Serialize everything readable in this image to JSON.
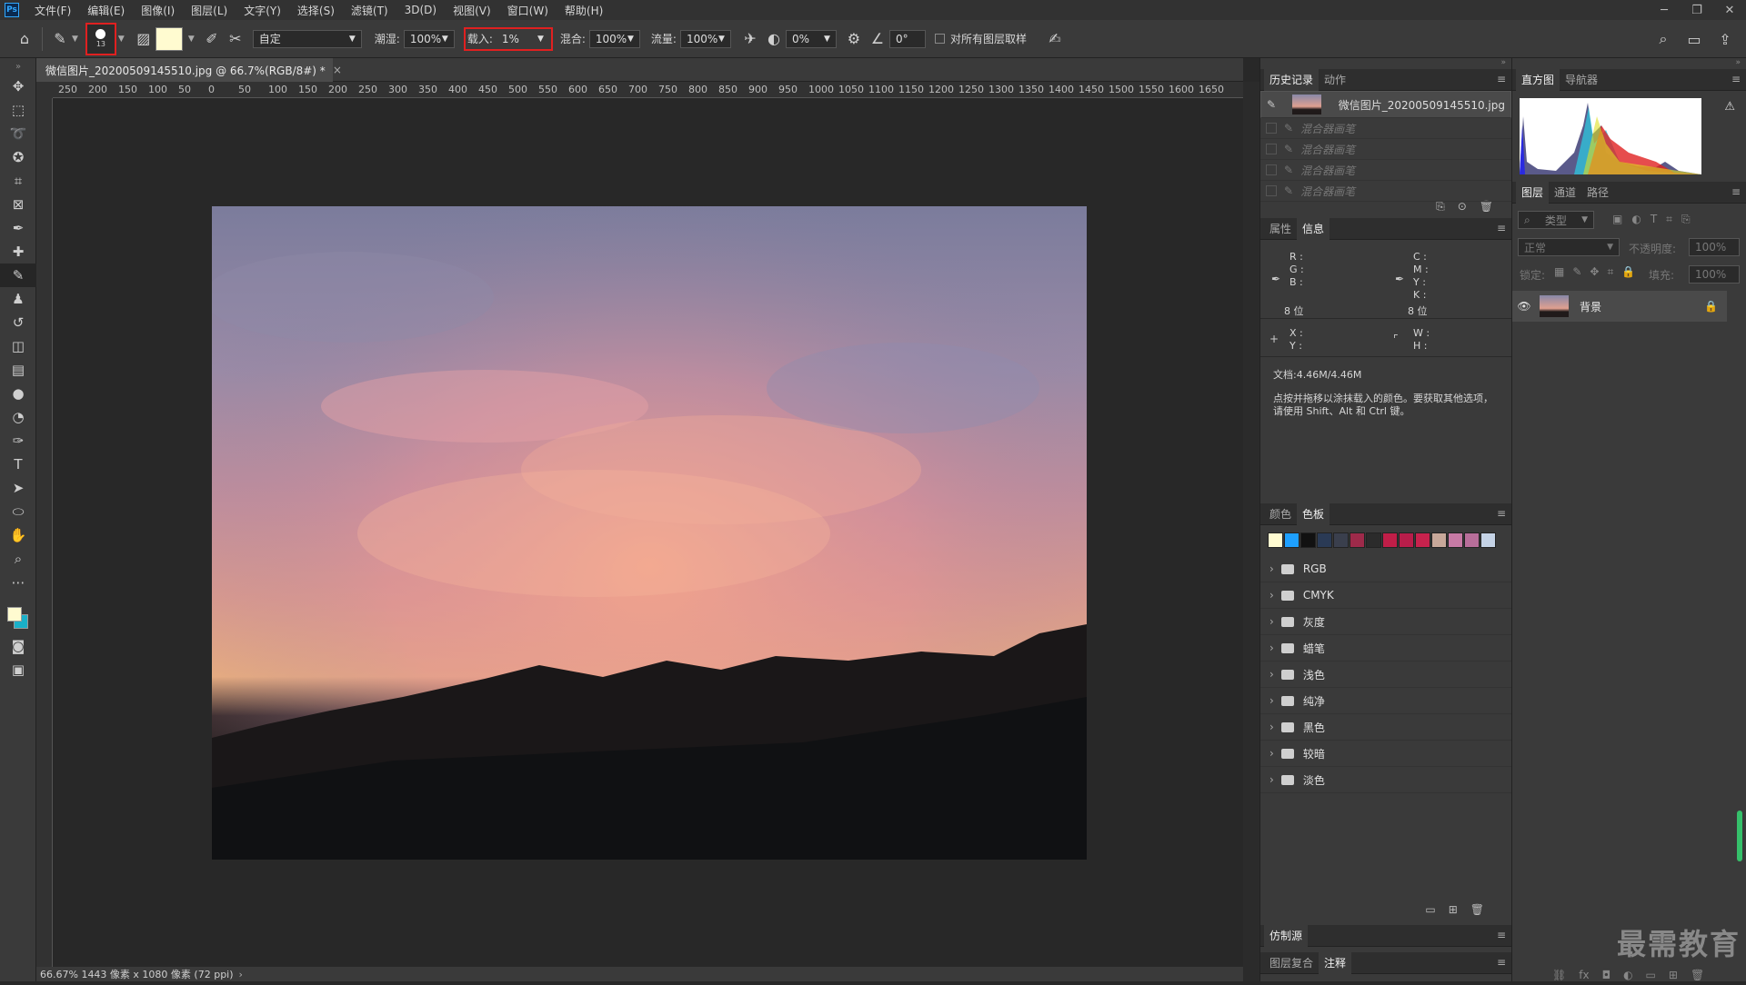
{
  "app": {
    "logo": "Ps",
    "menus": [
      "文件(F)",
      "编辑(E)",
      "图像(I)",
      "图层(L)",
      "文字(Y)",
      "选择(S)",
      "滤镜(T)",
      "3D(D)",
      "视图(V)",
      "窗口(W)",
      "帮助(H)"
    ]
  },
  "options": {
    "brush_size": "13",
    "preset": "自定",
    "wet_label": "潮湿:",
    "wet_value": "100%",
    "load_label": "载入:",
    "load_value": "1%",
    "mix_label": "混合:",
    "mix_value": "100%",
    "flow_label": "流量:",
    "flow_value": "100%",
    "smooth_value": "0%",
    "angle_value": "0°",
    "sample_all_label": "对所有图层取样",
    "swatch_color": "#fffbd0"
  },
  "document": {
    "tab_title": "微信图片_20200509145510.jpg @ 66.7%(RGB/8#) *",
    "ruler_ticks": [
      "250",
      "200",
      "150",
      "100",
      "50",
      "0",
      "50",
      "100",
      "150",
      "200",
      "250",
      "300",
      "350",
      "400",
      "450",
      "500",
      "550",
      "600",
      "650",
      "700",
      "750",
      "800",
      "850",
      "900",
      "950",
      "1000",
      "1050",
      "1100",
      "1150",
      "1200",
      "1250",
      "1300",
      "1350",
      "1400",
      "1450",
      "1500",
      "1550",
      "1600",
      "1650"
    ],
    "status": "66.67%  1443 像素 x 1080 像素 (72 ppi)"
  },
  "history": {
    "tabs": [
      "历史记录",
      "动作"
    ],
    "snapshot": "微信图片_20200509145510.jpg",
    "steps": [
      "混合器画笔",
      "混合器画笔",
      "混合器画笔",
      "混合器画笔"
    ]
  },
  "info": {
    "tabs": [
      "属性",
      "信息"
    ],
    "rgb": "R :\nG :\nB :",
    "cmyk": "C :\nM :\nY :\nK :",
    "bits_left": "8 位",
    "bits_right": "8 位",
    "xy": "X :\nY :",
    "wh": "W :\nH :",
    "doc": "文档:4.46M/4.46M",
    "hint": "点按并拖移以涂抹载入的颜色。要获取其他选项，请使用 Shift、Alt 和 Ctrl 键。"
  },
  "swatches": {
    "tabs": [
      "颜色",
      "色板"
    ],
    "colors": [
      "#fffbd0",
      "#1ea0ff",
      "#111111",
      "#2a3a55",
      "#3a3f4d",
      "#9e2a4a",
      "#2b2b2b",
      "#c01e48",
      "#b81d4a",
      "#c7224d",
      "#c8a89a",
      "#c77aa5",
      "#b86e9a",
      "#c5d3e6"
    ],
    "groups": [
      "RGB",
      "CMYK",
      "灰度",
      "蜡笔",
      "浅色",
      "纯净",
      "黑色",
      "较暗",
      "淡色"
    ]
  },
  "bottom_panels": {
    "clone": "仿制源",
    "tabs": [
      "图层复合",
      "注释"
    ]
  },
  "histogram": {
    "tabs": [
      "直方图",
      "导航器"
    ]
  },
  "layers": {
    "tabs": [
      "图层",
      "通道",
      "路径"
    ],
    "filter": "类型",
    "blend": "正常",
    "opacity_label": "不透明度:",
    "opacity_value": "100%",
    "lock_label": "锁定:",
    "fill_label": "填充:",
    "fill_value": "100%",
    "layer_name": "背景"
  },
  "watermark": "最需教育"
}
